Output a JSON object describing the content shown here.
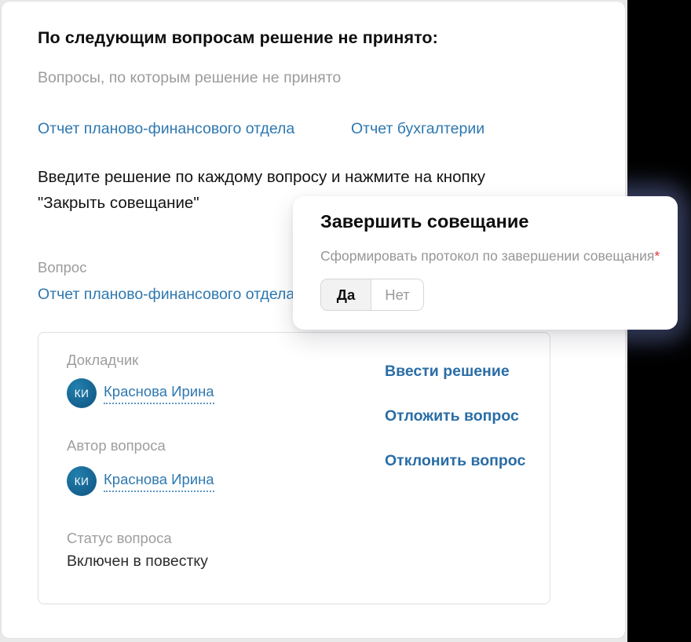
{
  "page": {
    "heading": "По следующим вопросам решение не принято:",
    "subtitle": "Вопросы, по которым решение не принято",
    "pending_questions": [
      "Отчет планово-финансового отдела",
      "Отчет бухгалтерии"
    ],
    "instruction_line1": "Введите решение по каждому вопросу и нажмите на кнопку",
    "instruction_line2": "\"Закрыть совещание\"",
    "question_label": "Вопрос",
    "question_link": "Отчет планово-финансового отдела"
  },
  "question_card": {
    "speaker_label": "Докладчик",
    "speaker": {
      "initials": "КИ",
      "name": "Краснова Ирина"
    },
    "author_label": "Автор вопроса",
    "author": {
      "initials": "КИ",
      "name": "Краснова Ирина"
    },
    "status_label": "Статус вопроса",
    "status_value": "Включен в повестку",
    "actions": [
      "Ввести решение",
      "Отложить вопрос",
      "Отклонить вопрос"
    ]
  },
  "modal": {
    "title": "Завершить совещание",
    "field_label": "Сформировать протокол по завершении совещания",
    "required_mark": "*",
    "options": [
      {
        "label": "Да",
        "selected": true
      },
      {
        "label": "Нет",
        "selected": false
      }
    ]
  },
  "colors": {
    "link_blue": "#2e78b0",
    "action_blue": "#2a6da6",
    "avatar_blue": "#17648f",
    "required_red": "#d93a32",
    "selected_toggle_bg": "#f2f2f2",
    "backdrop_black": "#000000",
    "glow_navy": "#3e476b"
  }
}
